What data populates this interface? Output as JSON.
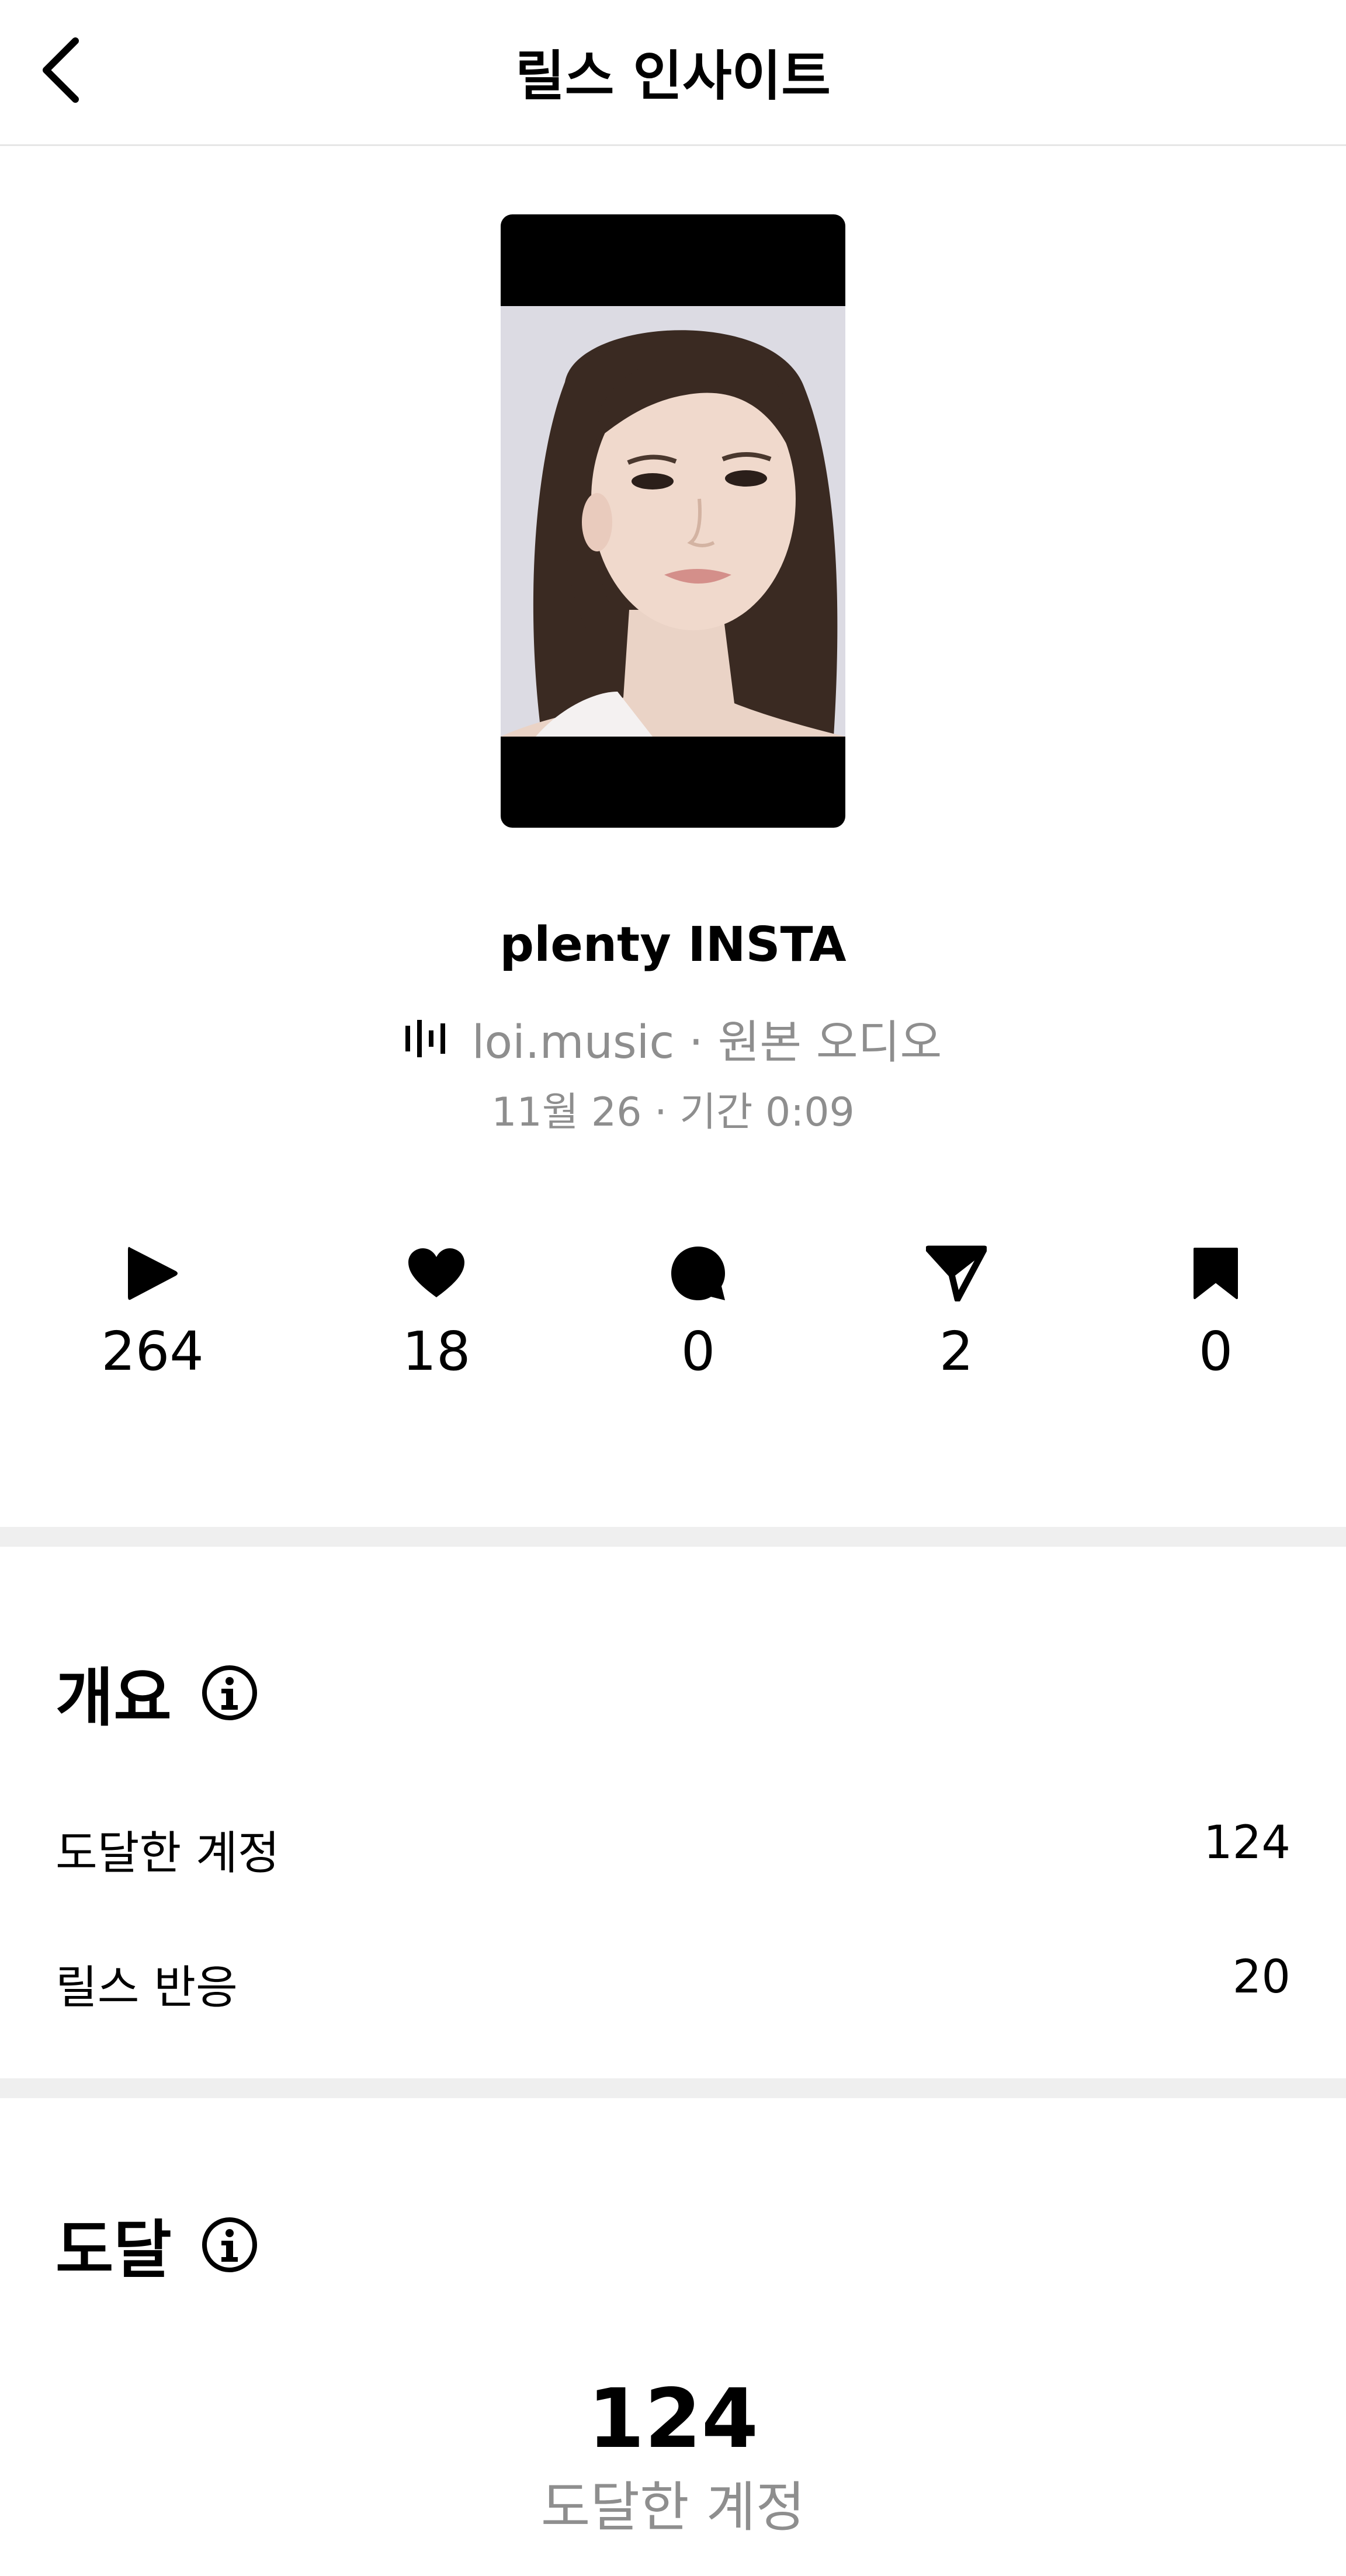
{
  "header": {
    "title": "릴스 인사이트"
  },
  "reel": {
    "title": "plenty INSTA",
    "audio": "loi.music · 원본 오디오",
    "date": "11월 26 · 기간 0:09"
  },
  "metrics": [
    {
      "icon": "play-icon",
      "value": "264"
    },
    {
      "icon": "heart-icon",
      "value": "18"
    },
    {
      "icon": "comment-icon",
      "value": "0"
    },
    {
      "icon": "share-icon",
      "value": "2"
    },
    {
      "icon": "bookmark-icon",
      "value": "0"
    }
  ],
  "overview": {
    "title": "개요",
    "rows": [
      {
        "label": "도달한 계정",
        "value": "124"
      },
      {
        "label": "릴스 반응",
        "value": "20"
      }
    ]
  },
  "reach": {
    "title": "도달",
    "value": "124",
    "label": "도달한 계정"
  }
}
